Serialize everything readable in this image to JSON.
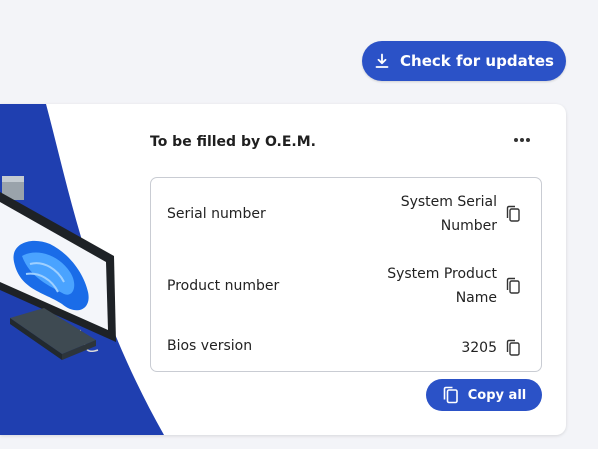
{
  "header": {
    "check_updates_label": "Check for updates"
  },
  "card": {
    "title": "To be filled by O.E.M.",
    "rows": [
      {
        "label": "Serial number",
        "value": "System Serial Number"
      },
      {
        "label": "Product number",
        "value": "System Product Name"
      },
      {
        "label": "Bios version",
        "value": "3205"
      }
    ],
    "copy_all_label": "Copy all"
  },
  "colors": {
    "accent": "#2b52c7",
    "illustration_blue": "#1f3fb0",
    "background": "#f3f4f8"
  },
  "icons": {
    "check_updates": "download-icon",
    "more": "more-horizontal-icon",
    "copy": "copy-icon"
  }
}
